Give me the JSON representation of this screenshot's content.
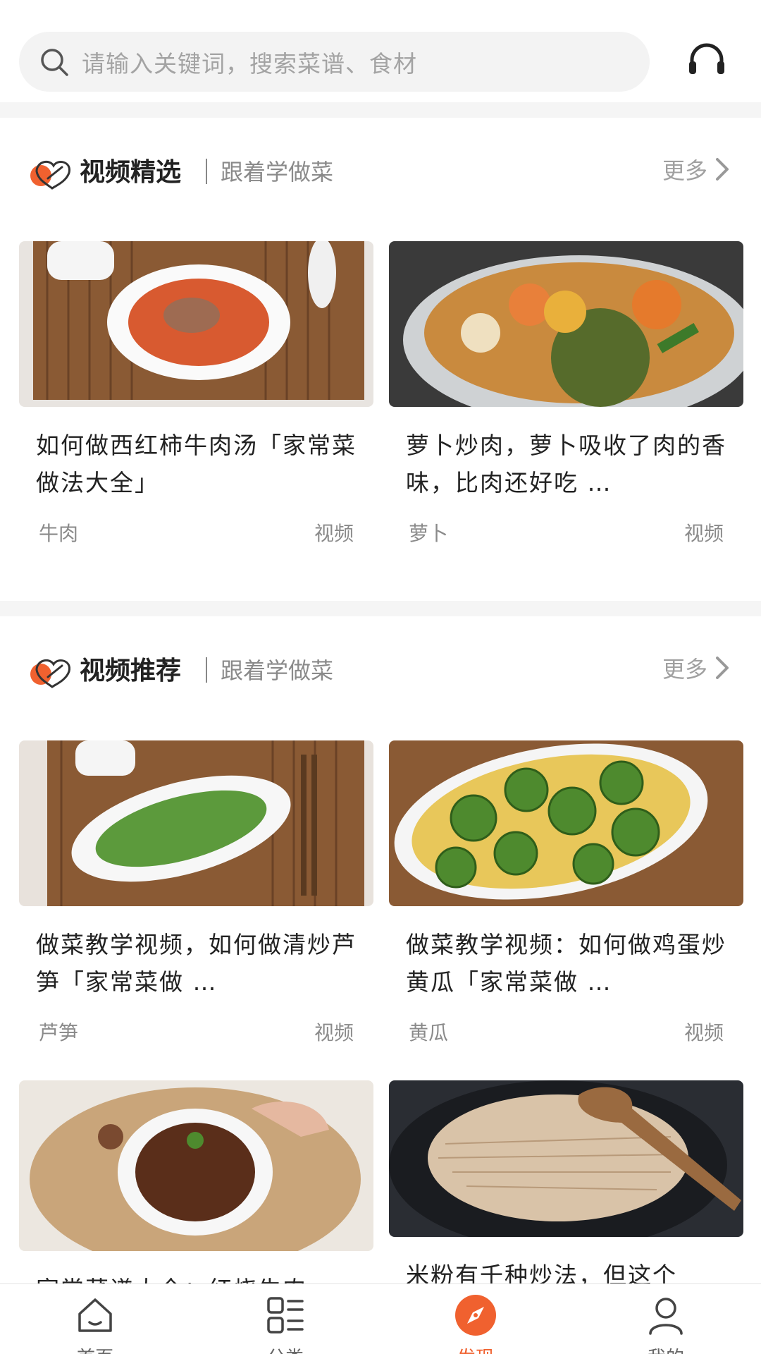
{
  "search": {
    "placeholder": "请输入关键词，搜索菜谱、食材"
  },
  "colors": {
    "accent": "#f0612f",
    "divider": "#f5f5f5",
    "text_secondary": "#8a8a8a"
  },
  "sections": [
    {
      "title": "视频精选",
      "subtitle": "跟着学做菜",
      "more": "更多",
      "cards": [
        {
          "title": "如何做西红柿牛肉汤「家常菜做法大全」",
          "tag": "牛肉",
          "type": "视频"
        },
        {
          "title": "萝卜炒肉，萝卜吸收了肉的香味，比肉还好吃 …",
          "tag": "萝卜",
          "type": "视频"
        }
      ]
    },
    {
      "title": "视频推荐",
      "subtitle": "跟着学做菜",
      "more": "更多",
      "cards": [
        {
          "title": "做菜教学视频，如何做清炒芦笋「家常菜做 …",
          "tag": "芦笋",
          "type": "视频"
        },
        {
          "title": "做菜教学视频：如何做鸡蛋炒黄瓜「家常菜做 …",
          "tag": "黄瓜",
          "type": "视频"
        },
        {
          "title": "家常菜谱大全：红烧牛肉",
          "tag": "",
          "type": ""
        },
        {
          "title": "米粉有千种炒法，但这个",
          "tag": "",
          "type": ""
        }
      ]
    }
  ],
  "bottom_nav": [
    {
      "label": "首页",
      "icon": "home-icon",
      "active": false
    },
    {
      "label": "分类",
      "icon": "category-icon",
      "active": false
    },
    {
      "label": "发现",
      "icon": "compass-icon",
      "active": true
    },
    {
      "label": "我的",
      "icon": "profile-icon",
      "active": false
    }
  ]
}
